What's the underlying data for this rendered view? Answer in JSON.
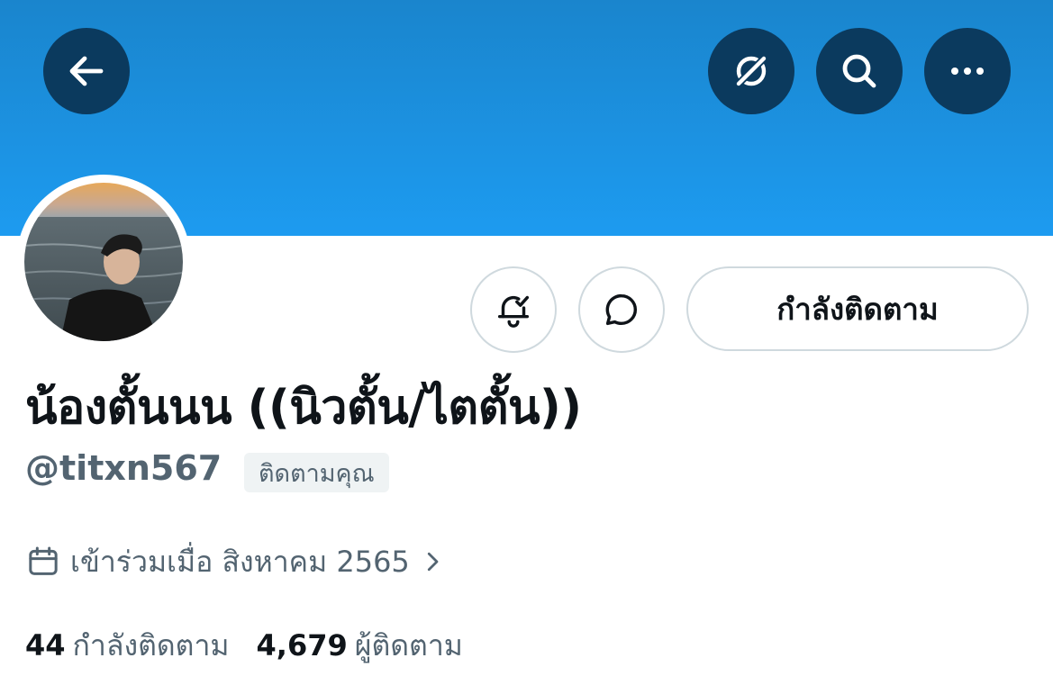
{
  "header": {
    "back_icon": "arrow-left-icon",
    "grok_icon": "slash-circle-icon",
    "search_icon": "search-icon",
    "more_icon": "more-horizontal-icon",
    "banner_color": "#1d9bf0",
    "button_color": "#0b3a5e"
  },
  "profile": {
    "avatar_desc": "avatar",
    "display_name": "น้องตั้นนน ((นิวตั้น/ไตตั้น))",
    "handle": "@titxn567",
    "follows_you": "ติดตามคุณ",
    "joined": "เข้าร่วมเมื่อ สิงหาคม 2565"
  },
  "actions": {
    "notify_icon": "bell-check-icon",
    "message_icon": "message-bubble-icon",
    "following_label": "กำลังติดตาม"
  },
  "stats": {
    "following_count": "44",
    "following_label": "กำลังติดตาม",
    "followers_count": "4,679",
    "followers_label": "ผู้ติดตาม"
  }
}
